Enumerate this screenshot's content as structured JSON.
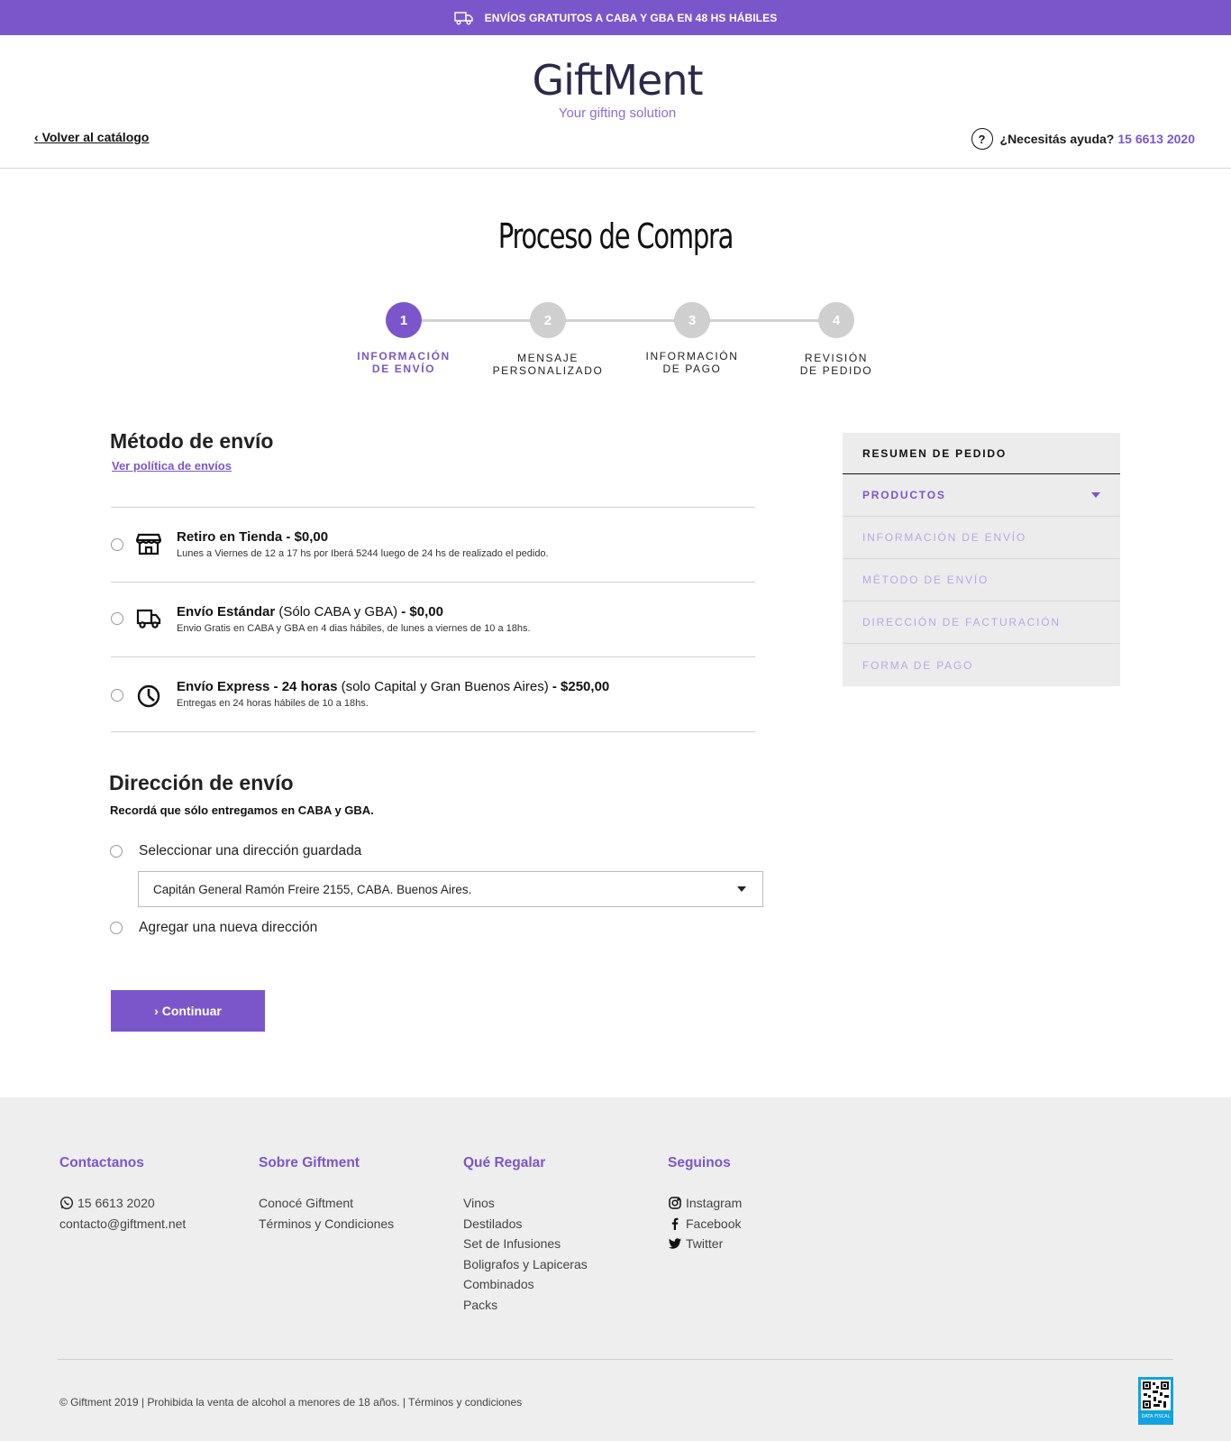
{
  "promo": {
    "text": "ENVÍOS GRATUITOS A CABA Y GBA EN 48 HS HÁBILES"
  },
  "header": {
    "back_prefix": "‹",
    "back_label": "Volver al catálogo",
    "logo_word": "GiftMent",
    "logo_tagline": "Your gifting solution",
    "help_label": "¿Necesitás ayuda?",
    "help_phone": "15 6613 2020"
  },
  "page": {
    "title": "Proceso de Compra"
  },
  "stepper": {
    "steps": [
      {
        "number": "1",
        "line1": "Información",
        "line2": "de envío"
      },
      {
        "number": "2",
        "line1": "Mensaje",
        "line2": "personalizado"
      },
      {
        "number": "3",
        "line1": "Información",
        "line2": "de pago"
      },
      {
        "number": "4",
        "line1": "Revisión",
        "line2": "de pedido"
      }
    ],
    "active_step": "1"
  },
  "shipping": {
    "heading": "Método de envío",
    "policy_link": "Ver política de envíos",
    "options": [
      {
        "icon": "store-icon",
        "title_bold": "Retiro en Tienda",
        "title_note": "",
        "price": " - $0,00",
        "desc": "Lunes a Viernes de 12 a 17 hs por Iberá 5244 luego de 24 hs de realizado el pedido."
      },
      {
        "icon": "truck-icon",
        "title_bold": "Envío Estándar",
        "title_note": " (Sólo CABA y GBA)",
        "price": " - $0,00",
        "desc": "Envio Gratis en CABA y GBA en 4 dias hábiles, de lunes a viernes de 10 a 18hs."
      },
      {
        "icon": "timer-icon",
        "title_bold": "Envío Express - 24 horas",
        "title_note": " (solo Capital y Gran Buenos Aires)",
        "price": " - $250,00",
        "desc": "Entregas en 24 horas hábiles de 10 a 18hs."
      }
    ]
  },
  "address": {
    "heading": "Dirección de envío",
    "note": "Recordá que sólo entregamos en CABA y GBA.",
    "saved_label": "Seleccionar una dirección guardada",
    "selected_value": "Capitán General Ramón Freire 2155, CABA. Buenos Aires.",
    "new_label": "Agregar una nueva dirección"
  },
  "actions": {
    "continue_label": "› Continuar"
  },
  "summary": {
    "heading": "Resumen de pedido",
    "items": [
      "Productos",
      "Información de envío",
      "Método de envío",
      "Dirección de facturación",
      "Forma de pago"
    ]
  },
  "footer": {
    "contact": {
      "heading": "Contactanos",
      "phone": "15 6613 2020",
      "email": "contacto@giftment.net"
    },
    "about": {
      "heading": "Sobre Giftment",
      "links": [
        "Conocé Giftment",
        "Términos y Condiciones"
      ]
    },
    "gifts": {
      "heading": "Qué Regalar",
      "links": [
        "Vinos",
        "Destilados",
        "Set de Infusiones",
        "Boligrafos y Lapiceras",
        "Combinados",
        "Packs"
      ]
    },
    "social": {
      "heading": "Seguinos",
      "links": [
        "Instagram",
        "Facebook",
        "Twitter"
      ]
    },
    "copyright": "© Giftment 2019 | Prohibida la venta de alcohol a menores de 18 años. | Términos y condiciones",
    "fiscal_label": "DATA FISCAL"
  },
  "colors": {
    "accent": "#7b56cb",
    "accent_light": "#b8a6e5",
    "footer_bg": "#eeeeee",
    "summary_bg": "#ececec"
  }
}
